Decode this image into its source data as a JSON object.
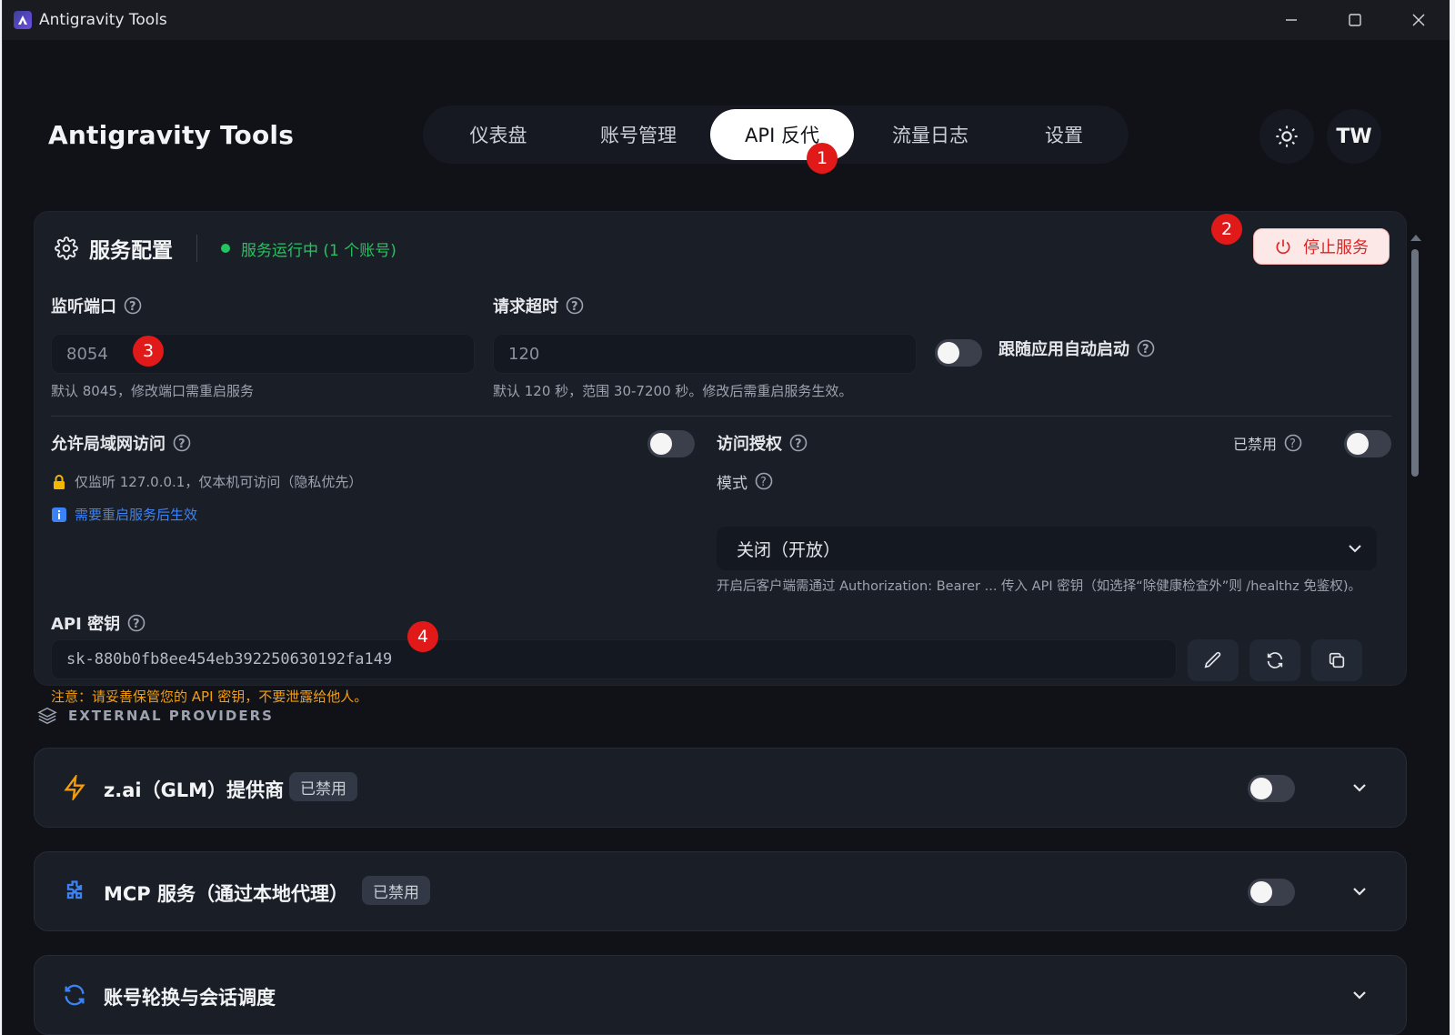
{
  "window": {
    "title": "Antigravity Tools"
  },
  "header": {
    "brand": "Antigravity Tools",
    "tabs": [
      {
        "label": "仪表盘",
        "active": false
      },
      {
        "label": "账号管理",
        "active": false
      },
      {
        "label": "API 反代",
        "active": true
      },
      {
        "label": "流量日志",
        "active": false
      },
      {
        "label": "设置",
        "active": false
      }
    ],
    "theme_icon": "sun-icon",
    "avatar": "TW"
  },
  "badges": [
    "1",
    "2",
    "3",
    "4"
  ],
  "service": {
    "title": "服务配置",
    "status": "服务运行中 (1 个账号)",
    "status_color": "#22c55e",
    "stop_label": "停止服务",
    "port": {
      "label": "监听端口",
      "value": "8054",
      "hint": "默认 8045，修改端口需重启服务"
    },
    "timeout": {
      "label": "请求超时",
      "value": "120",
      "hint": "默认 120 秒，范围 30-7200 秒。修改后需重启服务生效。"
    },
    "autostart": {
      "label": "跟随应用自动启动",
      "enabled": false
    },
    "lan": {
      "label": "允许局域网访问",
      "enabled": false,
      "note": "仅监听 127.0.0.1，仅本机可访问（隐私优先）",
      "restart_note": "需要重启服务后生效"
    },
    "auth": {
      "label": "访问授权",
      "state_label": "已禁用",
      "enabled": false,
      "mode_label": "模式",
      "mode_value": "关闭（开放）",
      "hint": "开启后客户端需通过 Authorization: Bearer ... 传入 API 密钥（如选择“除健康检查外”则 /healthz 免鉴权)。"
    },
    "api_key": {
      "label": "API 密钥",
      "value": "sk-880b0fb8ee454eb392250630192fa149",
      "warning": "注意：请妥善保管您的 API 密钥，不要泄露给他人。"
    }
  },
  "external": {
    "heading": "EXTERNAL PROVIDERS",
    "providers": [
      {
        "name": "z.ai（GLM）提供商",
        "badge": "已禁用",
        "enabled": false,
        "icon": "zap-icon",
        "color": "#f59e0b"
      },
      {
        "name": "MCP 服务（通过本地代理）",
        "badge": "已禁用",
        "enabled": false,
        "icon": "puzzle-icon",
        "color": "#3b82f6"
      },
      {
        "name": "账号轮换与会话调度",
        "icon": "refresh-icon",
        "color": "#3b82f6"
      }
    ]
  }
}
